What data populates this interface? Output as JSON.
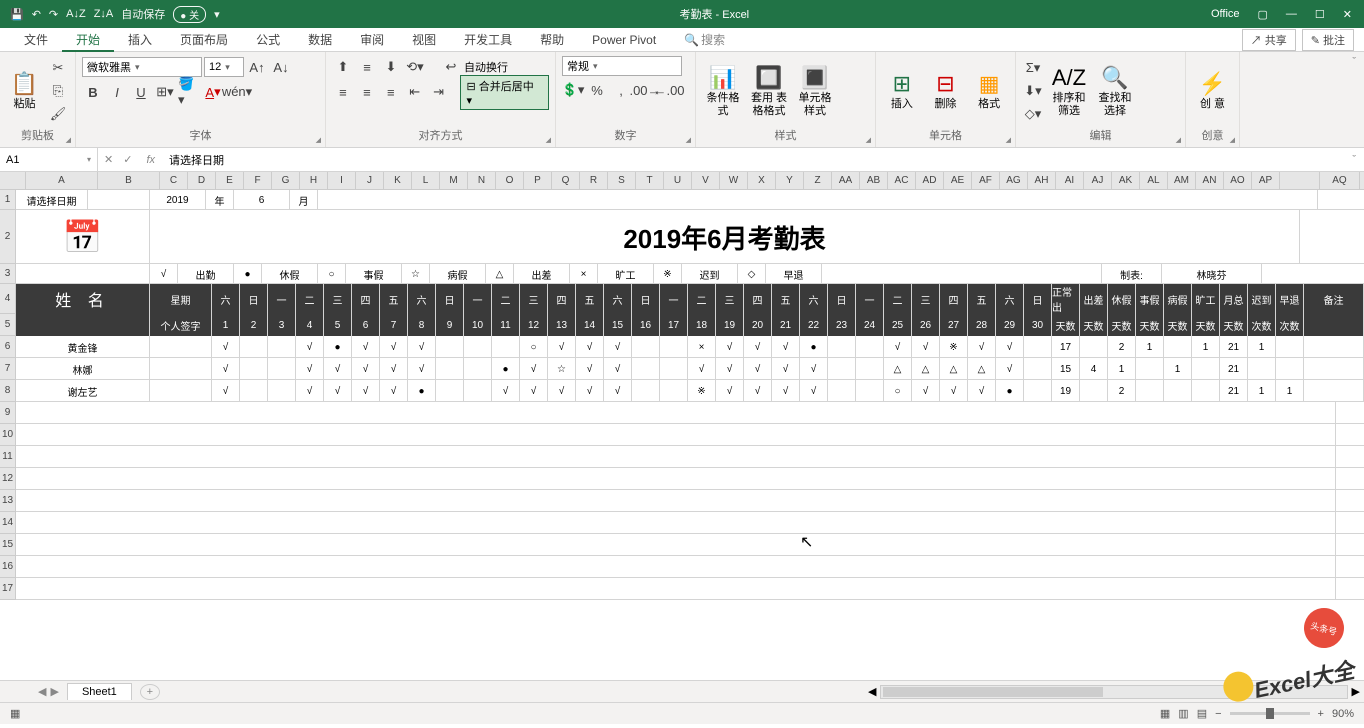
{
  "app": {
    "title": "考勤表 - Excel",
    "office_label": "Office"
  },
  "qat": {
    "save": "💾",
    "undo": "↶",
    "redo": "↷",
    "sortAsc": "A↓Z",
    "sortDesc": "Z↓A",
    "autosave": "自动保存",
    "autosave_state": "● 关"
  },
  "tabs": {
    "file": "文件",
    "home": "开始",
    "insert": "插入",
    "layout": "页面布局",
    "formula": "公式",
    "data": "数据",
    "review": "审阅",
    "view": "视图",
    "dev": "开发工具",
    "help": "帮助",
    "pivot": "Power Pivot",
    "search_icon": "🔍",
    "search": "搜索"
  },
  "actions": {
    "share": "共享",
    "comment": "批注"
  },
  "ribbon": {
    "paste": "粘贴",
    "clipboard": "剪贴板",
    "font_name": "微软雅黑",
    "font_size": "12",
    "font": "字体",
    "merge": "合并后居中",
    "wrap": "自动换行",
    "align": "对齐方式",
    "num_format": "常规",
    "number": "数字",
    "cond": "条件格式",
    "table": "套用\n表格格式",
    "cellstyle": "单元格样式",
    "styles": "样式",
    "ins": "插入",
    "del": "删除",
    "fmt": "格式",
    "cells": "单元格",
    "sort": "排序和筛选",
    "find": "查找和选择",
    "edit": "编辑",
    "idea": "创\n意",
    "ideas": "创意"
  },
  "namebox": "A1",
  "formula": "请选择日期",
  "cols": [
    "A",
    "B",
    "C",
    "D",
    "E",
    "F",
    "G",
    "H",
    "I",
    "J",
    "K",
    "L",
    "M",
    "N",
    "O",
    "P",
    "Q",
    "R",
    "S",
    "T",
    "U",
    "V",
    "W",
    "X",
    "Y",
    "Z",
    "AA",
    "AB",
    "AC",
    "AD",
    "AE",
    "AF",
    "AG",
    "AH",
    "AI",
    "AJ",
    "AK",
    "AL",
    "AM",
    "AN",
    "AO",
    "AP",
    "",
    "AQ"
  ],
  "row_nums": [
    "1",
    "2",
    "3",
    "4",
    "5",
    "6",
    "7",
    "8",
    "9",
    "10",
    "11",
    "12",
    "13",
    "14",
    "15",
    "16",
    "17"
  ],
  "r1": {
    "label": "请选择日期",
    "year": "2019",
    "year_l": "年",
    "month": "6",
    "month_l": "月"
  },
  "r2": {
    "title": "2019年6月考勤表"
  },
  "r3": {
    "legend": [
      [
        "√",
        "出勤"
      ],
      [
        "●",
        "休假"
      ],
      [
        "○",
        "事假"
      ],
      [
        "☆",
        "病假"
      ],
      [
        "△",
        "出差"
      ],
      [
        "×",
        "旷工"
      ],
      [
        "※",
        "迟到"
      ],
      [
        "◇",
        "早退"
      ]
    ],
    "maker": "制表:",
    "maker_name": "林晓芬"
  },
  "r4": {
    "name": "姓 名",
    "week": "星期",
    "wd": [
      "六",
      "日",
      "一",
      "二",
      "三",
      "四",
      "五",
      "六",
      "日",
      "一",
      "二",
      "三",
      "四",
      "五",
      "六",
      "日",
      "一",
      "二",
      "三",
      "四",
      "五",
      "六",
      "日",
      "一",
      "二",
      "三",
      "四",
      "五",
      "六",
      "日"
    ],
    "zcck": "正常出",
    "cc": "出差",
    "xj": "休假",
    "sj": "事假",
    "bj": "病假",
    "kg": "旷工",
    "yz": "月总",
    "cd": "迟到",
    "zt": "早退",
    "remark": "备注"
  },
  "r5": {
    "sign": "个人签字",
    "days": [
      "1",
      "2",
      "3",
      "4",
      "5",
      "6",
      "7",
      "8",
      "9",
      "10",
      "11",
      "12",
      "13",
      "14",
      "15",
      "16",
      "17",
      "18",
      "19",
      "20",
      "21",
      "22",
      "23",
      "24",
      "25",
      "26",
      "27",
      "28",
      "29",
      "30"
    ],
    "ds": "天数",
    "cs": "次数"
  },
  "people": [
    {
      "name": "黄金锋",
      "marks": [
        "√",
        "",
        "",
        "√",
        "●",
        "√",
        "√",
        "√",
        "",
        "",
        "",
        "○",
        "√",
        "√",
        "√",
        "",
        "",
        "×",
        "√",
        "√",
        "√",
        "●",
        "",
        "",
        "√",
        "√",
        "※",
        "√",
        "√",
        ""
      ],
      "stats": [
        "17",
        "",
        "2",
        "1",
        "",
        "1",
        "21",
        "1",
        ""
      ]
    },
    {
      "name": "林娜",
      "marks": [
        "√",
        "",
        "",
        "√",
        "√",
        "√",
        "√",
        "√",
        "",
        "",
        "●",
        "√",
        "☆",
        "√",
        "√",
        "",
        "",
        "√",
        "√",
        "√",
        "√",
        "√",
        "",
        "",
        "△",
        "△",
        "△",
        "△",
        "√",
        ""
      ],
      "stats": [
        "15",
        "4",
        "1",
        "",
        "1",
        "",
        "21",
        "",
        ""
      ]
    },
    {
      "name": "谢左艺",
      "marks": [
        "√",
        "",
        "",
        "√",
        "√",
        "√",
        "√",
        "●",
        "",
        "",
        "√",
        "√",
        "√",
        "√",
        "√",
        "",
        "",
        "※",
        "√",
        "√",
        "√",
        "√",
        "",
        "",
        "○",
        "√",
        "√",
        "√",
        "●",
        ""
      ],
      "stats": [
        "19",
        "",
        "2",
        "",
        "",
        "",
        "21",
        "1",
        "1"
      ]
    }
  ],
  "sheet_tab": "Sheet1",
  "zoom": "90%",
  "watermark": "Excel大全"
}
